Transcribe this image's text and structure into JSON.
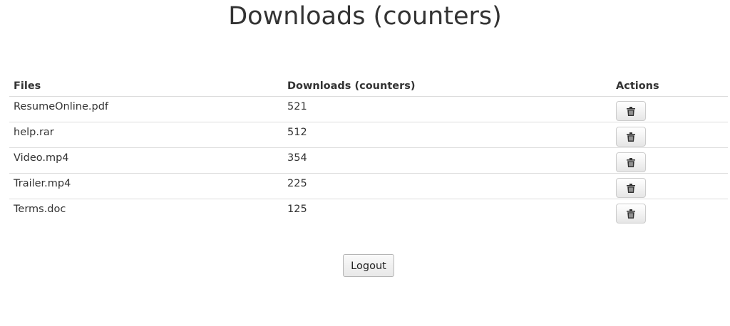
{
  "page": {
    "title": "Downloads (counters)"
  },
  "table": {
    "headers": {
      "file": "Files",
      "count": "Downloads (counters)",
      "actions": "Actions"
    },
    "rows": [
      {
        "file": "ResumeOnline.pdf",
        "count": "521",
        "action_icon": "trash-icon"
      },
      {
        "file": "help.rar",
        "count": "512",
        "action_icon": "trash-icon"
      },
      {
        "file": "Video.mp4",
        "count": "354",
        "action_icon": "trash-icon"
      },
      {
        "file": "Trailer.mp4",
        "count": "225",
        "action_icon": "trash-icon"
      },
      {
        "file": "Terms.doc",
        "count": "125",
        "action_icon": "trash-icon"
      }
    ]
  },
  "footer": {
    "logout_label": "Logout"
  }
}
